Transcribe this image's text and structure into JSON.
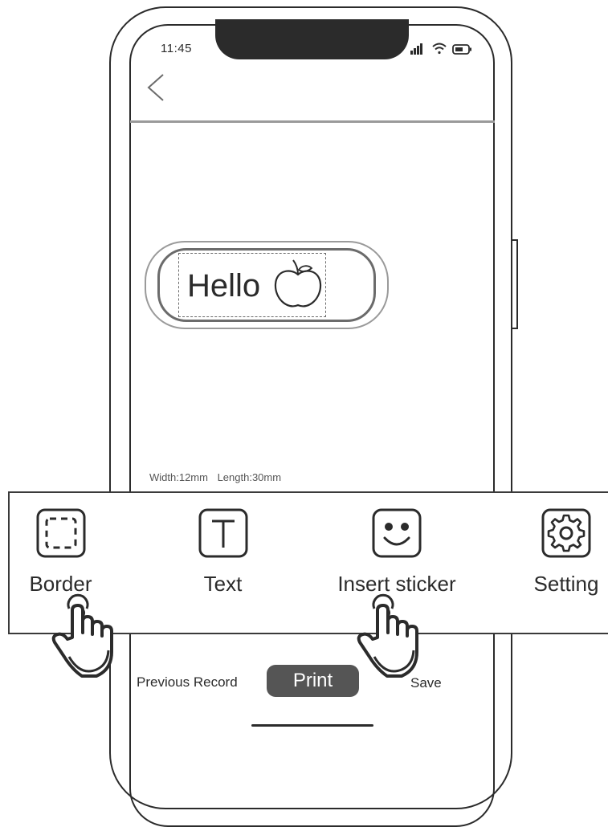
{
  "status_bar": {
    "time": "11:45",
    "icons": [
      "signal-icon",
      "wifi-icon",
      "battery-icon"
    ]
  },
  "header": {
    "back_icon": "chevron-left-icon"
  },
  "label_preview": {
    "text": "Hello",
    "sticker_icon": "apple-icon"
  },
  "dimensions": {
    "text": "Width:12mm   Length:30mm"
  },
  "toolbar": {
    "items": [
      {
        "label": "Border",
        "icon": "border-icon"
      },
      {
        "label": "Text",
        "icon": "text-icon"
      },
      {
        "label": "Insert sticker",
        "icon": "smiley-icon"
      },
      {
        "label": "Setting",
        "icon": "gear-icon"
      }
    ]
  },
  "bottom_bar": {
    "previous_record_label": "Previous Record",
    "print_label": "Print",
    "save_label": "Save"
  },
  "colors": {
    "ink": "#2b2b2b",
    "print_button": "#555555",
    "divider": "#9a9a9a"
  }
}
